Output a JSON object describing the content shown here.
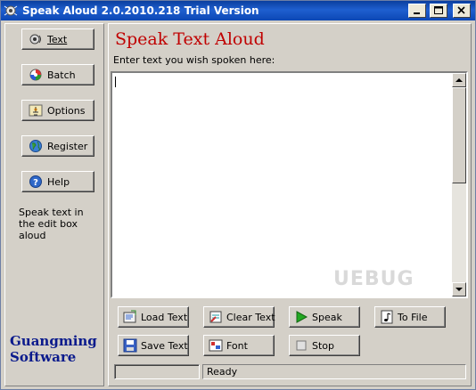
{
  "window": {
    "title": "Speak Aloud 2.0.2010.218 Trial Version",
    "title_bar_color": "#1f5fcf"
  },
  "sidebar": {
    "buttons": [
      {
        "label": "Text",
        "icon": "speaker-icon"
      },
      {
        "label": "Batch",
        "icon": "batch-icon"
      },
      {
        "label": "Options",
        "icon": "options-icon"
      },
      {
        "label": "Register",
        "icon": "register-icon"
      },
      {
        "label": "Help",
        "icon": "help-icon"
      }
    ],
    "hint": "Speak text in the edit box aloud",
    "brand_line1": "Guangming",
    "brand_line2": "Software",
    "brand_color": "#0a1a8c"
  },
  "main": {
    "heading": "Speak Text Aloud",
    "heading_color": "#c00000",
    "prompt": "Enter text you wish spoken here:",
    "edit_value": "",
    "watermark": "UEBUG"
  },
  "actions": {
    "load_text": "Load Text",
    "clear_text": "Clear Text",
    "speak": "Speak",
    "to_file": "To File",
    "save_text": "Save Text",
    "font": "Font",
    "stop": "Stop"
  },
  "status": {
    "text": "Ready"
  }
}
